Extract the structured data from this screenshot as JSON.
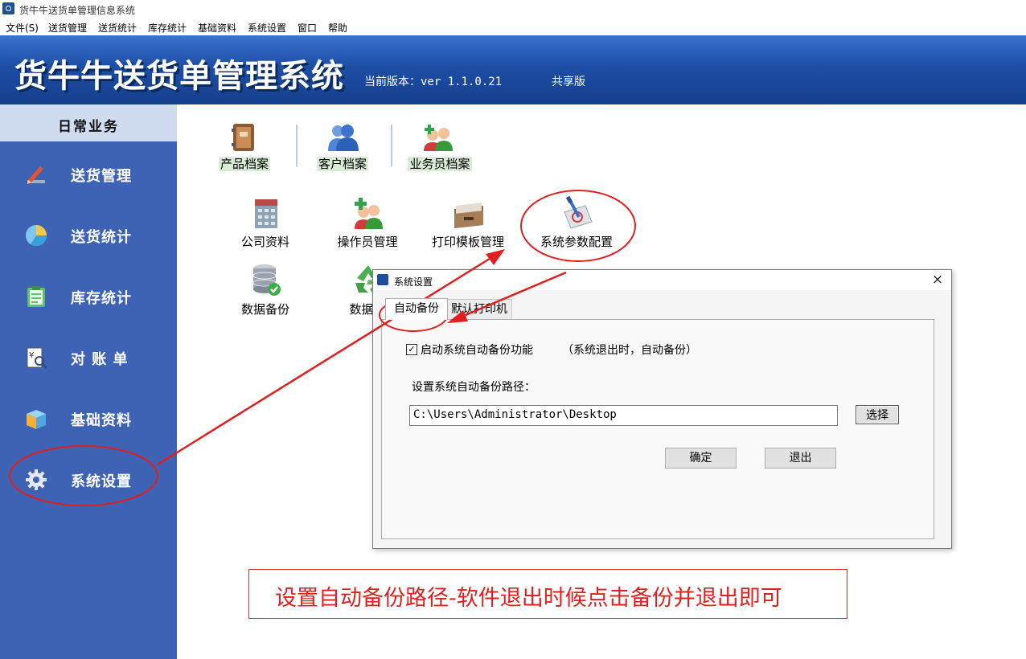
{
  "window": {
    "title": "货牛牛送货单管理信息系统"
  },
  "menu": [
    "文件(S)",
    "送货管理",
    "送货统计",
    "库存统计",
    "基础资料",
    "系统设置",
    "窗口",
    "帮助"
  ],
  "banner": {
    "title": "货牛牛送货单管理系统",
    "version": "当前版本：ver 1.1.0.21",
    "edition": "共享版"
  },
  "sidebar": {
    "header": "日常业务",
    "items": [
      {
        "label": "送货管理",
        "icon": "pencil-icon"
      },
      {
        "label": "送货统计",
        "icon": "pie-chart-icon"
      },
      {
        "label": "库存统计",
        "icon": "clipboard-icon"
      },
      {
        "label": "对 账 单",
        "icon": "statement-search-icon"
      },
      {
        "label": "基础资料",
        "icon": "box-icon"
      },
      {
        "label": "系统设置",
        "icon": "gear-icon"
      }
    ]
  },
  "toolbar": [
    "产品档案",
    "客户档案",
    "业务员档案"
  ],
  "functions": [
    "公司资料",
    "操作员管理",
    "打印模板管理",
    "系统参数配置",
    "数据备份",
    "数据还"
  ],
  "dialog": {
    "title": "系统设置",
    "close": "×",
    "tabs": [
      "自动备份",
      "默认打印机"
    ],
    "checkbox_label": "启动系统自动备份功能",
    "checkbox_mark": "✓",
    "checkbox_note": "（系统退出时，自动备份）",
    "path_label": "设置系统自动备份路径：",
    "path_value": "C:\\Users\\Administrator\\Desktop",
    "choose_button": "选择",
    "ok_button": "确定",
    "exit_button": "退出"
  },
  "annotation": "设置自动备份路径-软件退出时候点击备份并退出即可",
  "colors": {
    "banner": "#1d4ea6",
    "sidebar": "#3f63b4",
    "annotation": "#e02020"
  }
}
